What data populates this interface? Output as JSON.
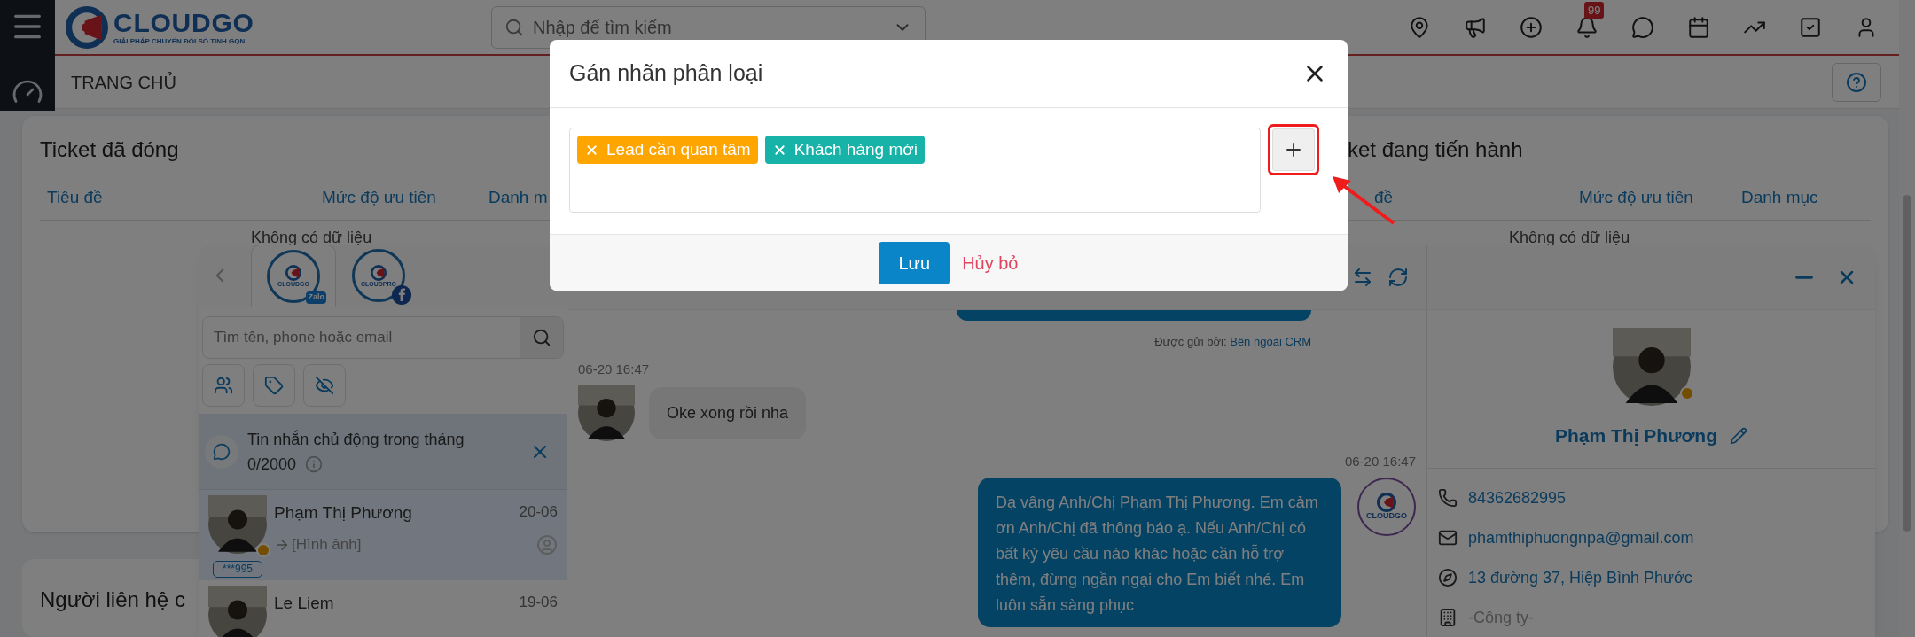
{
  "header": {
    "logo_name": "CLOUDGO",
    "logo_tagline": "GIẢI PHÁP CHUYỂN ĐỔI SỐ TINH GỌN",
    "search": {
      "placeholder": "Nhập để tìm kiếm"
    },
    "notification_badge": "99"
  },
  "page_title": "TRANG CHỦ",
  "cards": [
    {
      "title": "Ticket đã đóng",
      "columns": [
        "Tiêu đề",
        "Mức độ ưu tiên",
        "Danh m"
      ],
      "empty_text": "Không có dữ liệu"
    },
    {
      "title": "Người liên hệ c"
    },
    {
      "title": "ket đang tiến hành",
      "columns": [
        "đề",
        "Mức độ ưu tiên",
        "Danh mục"
      ],
      "empty_text": "Không có dữ liệu"
    }
  ],
  "chat": {
    "channels": [
      {
        "kind": "zalo",
        "name": "CLOUDGO",
        "badge": "Zalo",
        "selected": true
      },
      {
        "kind": "facebook",
        "name": "CLOUDPRO",
        "selected": false
      }
    ],
    "search": {
      "placeholder": "Tìm tên, phone hoặc email"
    },
    "banner": {
      "text": "Tin nhắn chủ động trong tháng",
      "count": "0/2000"
    },
    "conversations": [
      {
        "name": "Phạm Thị Phương",
        "date": "20-06",
        "preview": "[Hình ảnh]",
        "tag": "***995",
        "selected": true
      },
      {
        "name": "Le Liem",
        "date": "19-06",
        "selected": false
      }
    ],
    "messages": [
      {
        "kind": "outgoing_tail",
        "footer_label": "Được gửi bởi:",
        "footer_value": "Bên ngoài CRM"
      },
      {
        "kind": "incoming",
        "time": "06-20 16:47",
        "text": "Oke xong rồi nha"
      },
      {
        "kind": "outgoing",
        "time": "06-20 16:47",
        "text": "Dạ vâng Anh/Chị Phạm Thị Phương. Em cảm ơn Anh/Chị đã thông báo ạ. Nếu Anh/Chị có bất kỳ yêu cầu nào khác hoặc cần hỗ trợ thêm, đừng ngần ngại cho Em biết nhé. Em luôn sẵn sàng phục",
        "agent_logo": "CLOUDGO"
      }
    ],
    "profile": {
      "name": "Phạm Thị Phương",
      "phone": "84362682995",
      "email": "phamthiphuongnpa@gmail.com",
      "address": "13 đường 37, Hiệp Bình Phước",
      "company_placeholder": "-Công ty-"
    }
  },
  "modal": {
    "title": "Gán nhãn phân loại",
    "tags": [
      {
        "label": "Lead cần quan tâm",
        "color": "#ffa500"
      },
      {
        "label": "Khách hàng mới",
        "color": "#17b2a8"
      }
    ],
    "save": "Lưu",
    "cancel": "Hủy bỏ"
  }
}
